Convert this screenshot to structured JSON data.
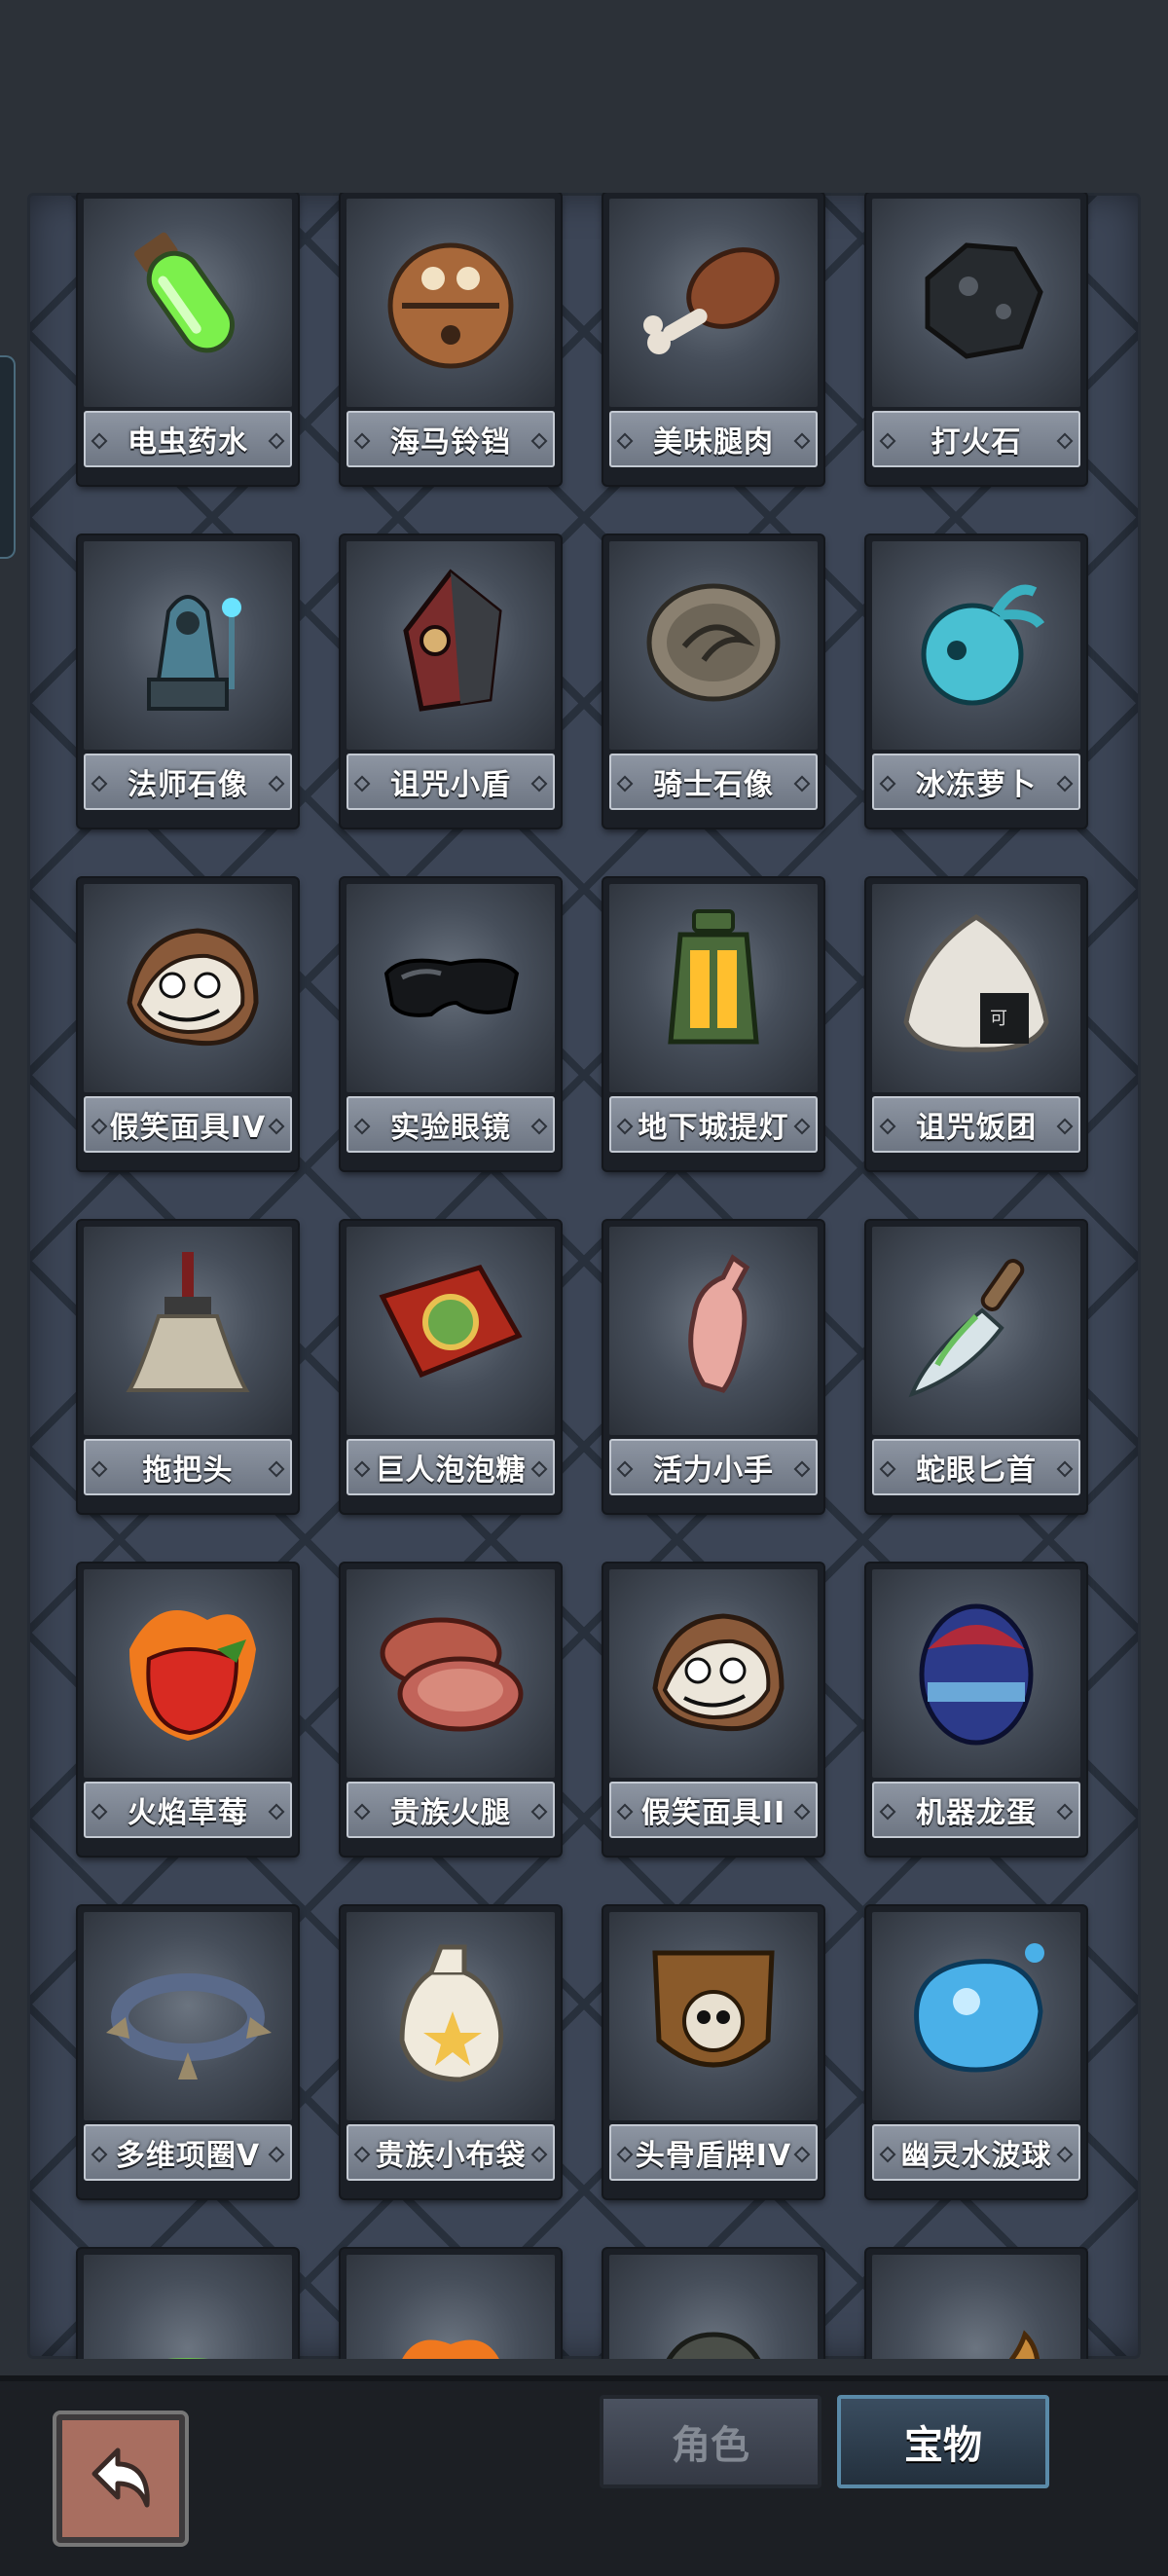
{
  "items": [
    {
      "name": "电虫药水",
      "icon": "green-potion-icon"
    },
    {
      "name": "海马铃铛",
      "icon": "bronze-bell-icon"
    },
    {
      "name": "美味腿肉",
      "icon": "meat-leg-icon"
    },
    {
      "name": "打火石",
      "icon": "flint-stone-icon"
    },
    {
      "name": "法师石像",
      "icon": "mage-statue-icon"
    },
    {
      "name": "诅咒小盾",
      "icon": "cursed-shield-icon"
    },
    {
      "name": "骑士石像",
      "icon": "knight-stone-icon"
    },
    {
      "name": "冰冻萝卜",
      "icon": "frozen-radish-icon"
    },
    {
      "name": "假笑面具IV",
      "icon": "smile-mask-icon"
    },
    {
      "name": "实验眼镜",
      "icon": "goggles-icon"
    },
    {
      "name": "地下城提灯",
      "icon": "lantern-icon"
    },
    {
      "name": "诅咒饭团",
      "icon": "rice-ball-icon"
    },
    {
      "name": "拖把头",
      "icon": "mop-head-icon"
    },
    {
      "name": "巨人泡泡糖",
      "icon": "bubblegum-box-icon"
    },
    {
      "name": "活力小手",
      "icon": "hand-icon"
    },
    {
      "name": "蛇眼匕首",
      "icon": "dagger-icon"
    },
    {
      "name": "火焰草莓",
      "icon": "fire-strawberry-icon"
    },
    {
      "name": "贵族火腿",
      "icon": "ham-slices-icon"
    },
    {
      "name": "假笑面具II",
      "icon": "smile-mask-icon"
    },
    {
      "name": "机器龙蛋",
      "icon": "robot-egg-icon"
    },
    {
      "name": "多维项圈V",
      "icon": "spiked-collar-icon"
    },
    {
      "name": "贵族小布袋",
      "icon": "cloth-bag-icon"
    },
    {
      "name": "头骨盾牌IV",
      "icon": "skull-shield-icon"
    },
    {
      "name": "幽灵水波球",
      "icon": "water-orb-icon"
    },
    {
      "name": "",
      "icon": "tea-cup-icon"
    },
    {
      "name": "",
      "icon": "fire-heart-icon"
    },
    {
      "name": "",
      "icon": "rune-stone-icon"
    },
    {
      "name": "",
      "icon": "sausage-icon"
    }
  ],
  "tabs": {
    "role": "角色",
    "treasure": "宝物"
  },
  "colors": {
    "panel": "#3c4556",
    "label": "#7e8693",
    "active_tab": "#5a8aa8"
  }
}
